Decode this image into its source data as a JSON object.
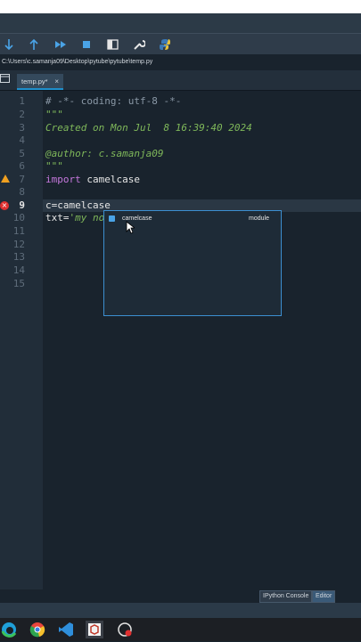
{
  "toolbar": {
    "buttons": [
      "step-into",
      "step-return",
      "continue",
      "stop",
      "maximize-pane",
      "preferences",
      "python-path-manager"
    ]
  },
  "path": "C:\\Users\\c.samanja09\\Desktop\\pytube\\pytube\\temp.py",
  "tabs": [
    {
      "label": "temp.py*",
      "close": "×"
    }
  ],
  "editor": {
    "line_numbers": [
      "1",
      "2",
      "3",
      "4",
      "5",
      "6",
      "7",
      "8",
      "9",
      "10",
      "11",
      "12",
      "13",
      "14",
      "15"
    ],
    "current_line": "9",
    "lines": {
      "l1": "# -*- coding: utf-8 -*-",
      "l2": "\"\"\"",
      "l3": "Created on Mon Jul  8 16:39:40 2024",
      "l5": "@author: c.samanja09",
      "l6": "\"\"\"",
      "l7_kw": "import",
      "l7_rest": " camelcase",
      "l9": "c=camelcase",
      "l10_a": "txt=",
      "l10_b": "'my no"
    }
  },
  "completion": {
    "items": [
      {
        "label": "camelcase",
        "type": "module"
      }
    ]
  },
  "panes": {
    "console": "IPython Console",
    "editor": "Editor"
  },
  "colors": {
    "accent": "#1e8fcc",
    "background": "#19232d",
    "keyword": "#c678dd",
    "string": "#7fb85a"
  }
}
